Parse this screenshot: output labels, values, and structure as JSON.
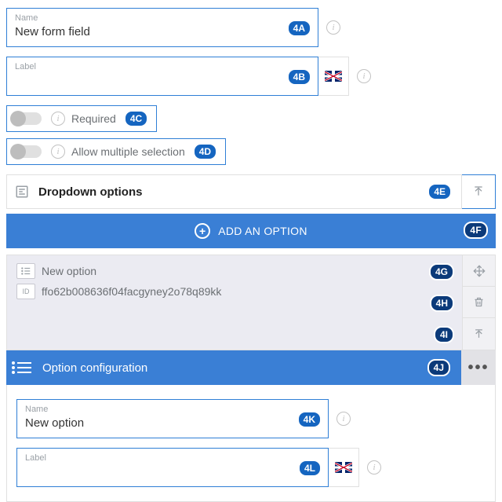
{
  "field_name": {
    "label": "Name",
    "value": "New form field"
  },
  "field_label": {
    "label": "Label",
    "value": ""
  },
  "toggle_required": {
    "label": "Required"
  },
  "toggle_multi": {
    "label": "Allow multiple selection"
  },
  "dropdown_section_title": "Dropdown options",
  "add_option_label": "ADD AN OPTION",
  "option": {
    "name": "New option",
    "id_label": "ID",
    "id_value": "ffo62b008636f04facgyney2o78q89kk"
  },
  "option_config_title": "Option configuration",
  "sub_name": {
    "label": "Name",
    "value": "New option"
  },
  "sub_label": {
    "label": "Label",
    "value": ""
  },
  "annotations": {
    "a": "4A",
    "b": "4B",
    "c": "4C",
    "d": "4D",
    "e": "4E",
    "f": "4F",
    "g": "4G",
    "h": "4H",
    "i": "4I",
    "j": "4J",
    "k": "4K",
    "l": "4L"
  }
}
